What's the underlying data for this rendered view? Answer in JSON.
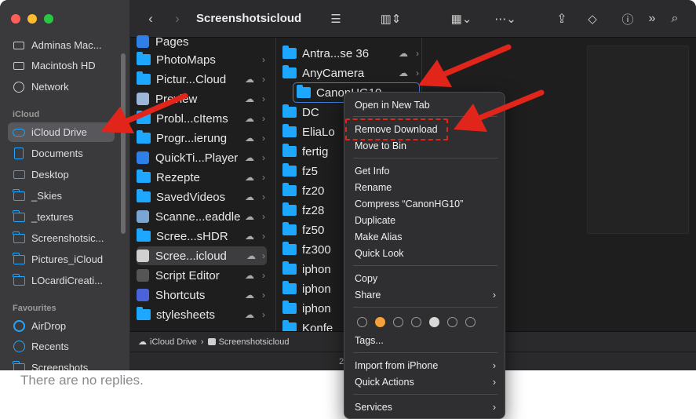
{
  "window": {
    "title": "Screenshotsicloud"
  },
  "sidebar": {
    "locations": [
      {
        "label": "Adminas Mac...",
        "icon": "computer-icon"
      },
      {
        "label": "Macintosh HD",
        "icon": "disk-icon"
      },
      {
        "label": "Network",
        "icon": "network-icon"
      }
    ],
    "icloud_header": "iCloud",
    "icloud": [
      {
        "label": "iCloud Drive",
        "icon": "cloud-icon",
        "selected": true
      },
      {
        "label": "Documents",
        "icon": "document-icon"
      },
      {
        "label": "Desktop",
        "icon": "desktop-icon"
      },
      {
        "label": "_Skies",
        "icon": "folder-icon"
      },
      {
        "label": "_textures",
        "icon": "folder-icon"
      },
      {
        "label": "Screenshotsic...",
        "icon": "folder-icon"
      },
      {
        "label": "Pictures_iCloud",
        "icon": "folder-icon"
      },
      {
        "label": "LOcardiCreati...",
        "icon": "folder-icon"
      }
    ],
    "favourites_header": "Favourites",
    "favourites": [
      {
        "label": "AirDrop",
        "icon": "airdrop-icon"
      },
      {
        "label": "Recents",
        "icon": "recents-icon"
      },
      {
        "label": "Screenshots",
        "icon": "folder-icon"
      }
    ]
  },
  "column1": [
    {
      "label": "Pages",
      "type": "app"
    },
    {
      "label": "PhotoMaps",
      "type": "folder",
      "chevron": true
    },
    {
      "label": "Pictur...Cloud",
      "type": "folder",
      "cloud": true,
      "chevron": true
    },
    {
      "label": "Preview",
      "type": "app",
      "cloud": true,
      "chevron": true
    },
    {
      "label": "Probl...cItems",
      "type": "folder",
      "cloud": true,
      "chevron": true
    },
    {
      "label": "Progr...ierung",
      "type": "folder",
      "cloud": true,
      "chevron": true
    },
    {
      "label": "QuickTi...Player",
      "type": "app",
      "cloud": true,
      "chevron": true
    },
    {
      "label": "Rezepte",
      "type": "folder",
      "cloud": true,
      "chevron": true
    },
    {
      "label": "SavedVideos",
      "type": "folder",
      "cloud": true,
      "chevron": true
    },
    {
      "label": "Scanne...eaddle",
      "type": "app",
      "cloud": true,
      "chevron": true
    },
    {
      "label": "Scree...sHDR",
      "type": "folder",
      "cloud": true,
      "chevron": true
    },
    {
      "label": "Scree...icloud",
      "type": "app",
      "cloud": true,
      "chevron": true,
      "selected": true
    },
    {
      "label": "Script Editor",
      "type": "app",
      "cloud": true,
      "chevron": true
    },
    {
      "label": "Shortcuts",
      "type": "app",
      "cloud": true,
      "chevron": true
    },
    {
      "label": "stylesheets",
      "type": "folder",
      "cloud": true,
      "chevron": true
    }
  ],
  "column2": [
    {
      "label": "Antra...se 36",
      "cloud": true,
      "chevron": true
    },
    {
      "label": "AnyCamera",
      "cloud": true,
      "chevron": true
    },
    {
      "label": "CanonHG10",
      "cloud": false,
      "chevron": true,
      "focused": true
    },
    {
      "label": "DC"
    },
    {
      "label": "EliaLo"
    },
    {
      "label": "fertig"
    },
    {
      "label": "fz5"
    },
    {
      "label": "fz20"
    },
    {
      "label": "fz28"
    },
    {
      "label": "fz50"
    },
    {
      "label": "fz300"
    },
    {
      "label": "iphon"
    },
    {
      "label": "iphon"
    },
    {
      "label": "iphon"
    },
    {
      "label": "Konfe"
    }
  ],
  "pathbar": {
    "root": "iCloud Drive",
    "separator": "›",
    "current": "Screenshotsicloud"
  },
  "statusbar": {
    "text": "2"
  },
  "context_menu": {
    "group1": [
      "Open in New Tab"
    ],
    "group2": [
      "Remove Download",
      "Move to Bin"
    ],
    "group3": [
      "Get Info",
      "Rename",
      "Compress “CanonHG10”",
      "Duplicate",
      "Make Alias",
      "Quick Look"
    ],
    "group4": [
      {
        "label": "Copy"
      },
      {
        "label": "Share",
        "submenu": true
      }
    ],
    "tags_label": "Tags...",
    "tag_colors": [
      "#2f2f31",
      "#f5a23b",
      "#2f2f31",
      "#2f2f31",
      "#d8d8d8",
      "#2f2f31",
      "#2f2f31"
    ],
    "group6": [
      {
        "label": "Import from iPhone",
        "submenu": true
      },
      {
        "label": "Quick Actions",
        "submenu": true
      }
    ],
    "group7": [
      {
        "label": "Services",
        "submenu": true
      }
    ]
  },
  "page": {
    "replies_text": "There are no replies."
  },
  "colors": {
    "accent": "#1ea7ff",
    "annotation": "#e2251b"
  }
}
